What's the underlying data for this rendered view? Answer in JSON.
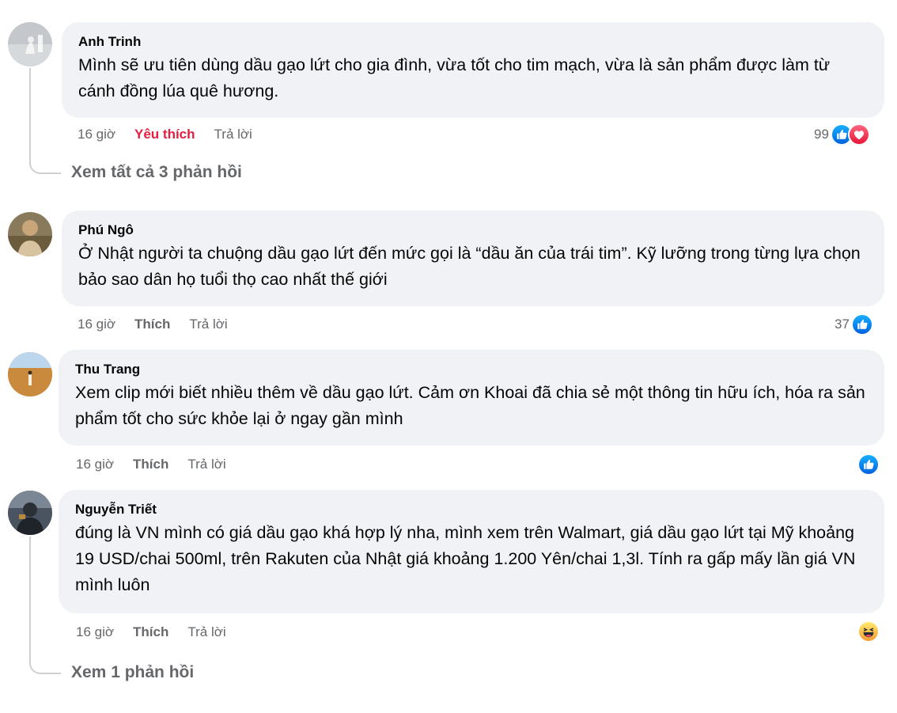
{
  "comments": [
    {
      "author": "Anh Trinh",
      "text": "Mình sẽ ưu tiên dùng dầu gạo lứt cho gia đình, vừa tốt cho tim mạch, vừa là sản phẩm được làm từ cánh đồng lúa quê hương.",
      "time": "16 giờ",
      "action": "Yêu thích",
      "reply": "Trả lời",
      "reaction_count": "99",
      "reactions": [
        "like-icon",
        "love-icon"
      ]
    },
    {
      "author": "Phú Ngô",
      "text": "Ở Nhật người ta chuộng dầu gạo lứt đến mức gọi là “dầu ăn của trái tim”. Kỹ lưỡng trong từng lựa chọn bảo sao dân họ tuổi thọ cao nhất thế giới",
      "time": "16 giờ",
      "action": "Thích",
      "reply": "Trả lời",
      "reaction_count": "37",
      "reactions": [
        "like-icon"
      ]
    },
    {
      "author": "Thu Trang",
      "text": "Xem clip mới biết nhiều thêm về dầu gạo lứt. Cảm ơn Khoai đã chia sẻ một thông tin hữu ích, hóa ra sản phẩm tốt cho sức khỏe lại ở ngay gần mình",
      "time": "16 giờ",
      "action": "Thích",
      "reply": "Trả lời",
      "reaction_count": "",
      "reactions": [
        "like-icon"
      ]
    },
    {
      "author": "Nguyễn Triết",
      "text": "đúng là VN mình có giá dầu gạo khá hợp lý nha, mình xem trên Walmart, giá dầu gạo lứt tại Mỹ khoảng 19 USD/chai 500ml, trên Rakuten của Nhật giá khoảng 1.200 Yên/chai 1,3l. Tính ra gấp mấy lần giá VN mình luôn",
      "time": "16 giờ",
      "action": "Thích",
      "reply": "Trả lời",
      "reaction_count": "",
      "reactions": [
        "haha-icon"
      ]
    }
  ],
  "view_replies": [
    "Xem tất cả 3 phản hồi",
    "Xem 1 phản hồi"
  ],
  "colors": {
    "bubble": "#f0f2f5",
    "meta": "#65676b",
    "loved": "#e41e3f",
    "like": "#0866ff",
    "love": "#f33e58",
    "haha": "#f7b125"
  }
}
